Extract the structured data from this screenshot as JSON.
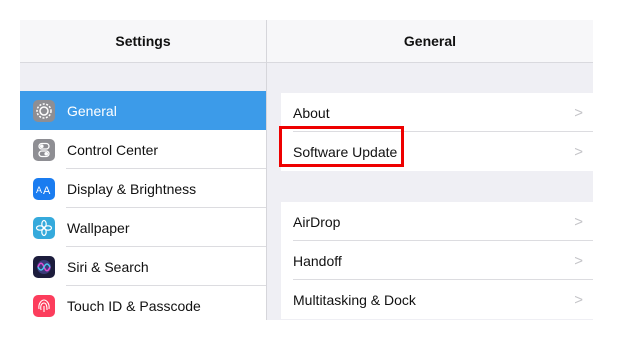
{
  "sidebar": {
    "title": "Settings",
    "items": [
      {
        "label": "General",
        "icon": "gear-icon",
        "color": "#8e8e93",
        "selected": true
      },
      {
        "label": "Control Center",
        "icon": "toggles-icon",
        "color": "#8e8e93"
      },
      {
        "label": "Display & Brightness",
        "icon": "text-size-icon",
        "color": "#1a7cf0"
      },
      {
        "label": "Wallpaper",
        "icon": "flower-icon",
        "color": "#35aadc"
      },
      {
        "label": "Siri & Search",
        "icon": "siri-icon",
        "color": "#1c1c3c"
      },
      {
        "label": "Touch ID & Passcode",
        "icon": "fingerprint-icon",
        "color": "#fc3d5c"
      }
    ]
  },
  "detail": {
    "title": "General",
    "groups": [
      [
        {
          "label": "About"
        },
        {
          "label": "Software Update"
        }
      ],
      [
        {
          "label": "AirDrop"
        },
        {
          "label": "Handoff"
        },
        {
          "label": "Multitasking & Dock"
        }
      ]
    ],
    "chevron": ">"
  },
  "highlight": {
    "target": "Software Update",
    "color": "#ee0000"
  }
}
